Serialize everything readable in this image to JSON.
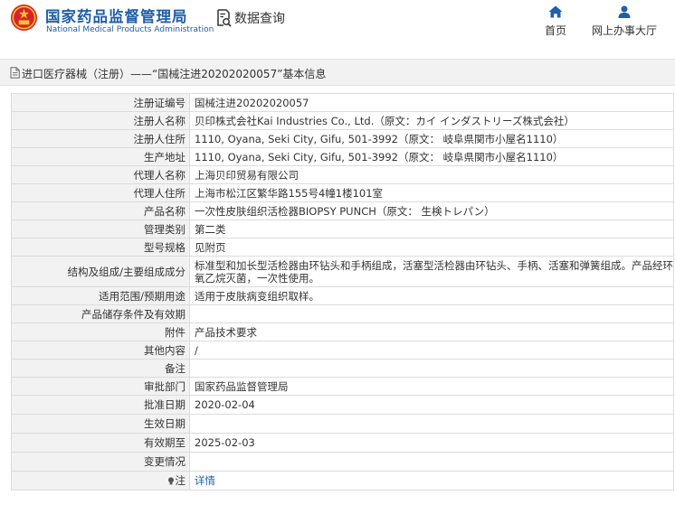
{
  "header": {
    "logo_cn": "国家药品监督管理局",
    "logo_en": "National Medical Products Administration",
    "data_query": "数据查询",
    "nav": {
      "home": "首页",
      "online": "网上办事大厅"
    }
  },
  "title": "进口医疗器械（注册）——“国械注进20202020057”基本信息",
  "rows": [
    {
      "label": "注册证编号",
      "value": "国械注进20202020057"
    },
    {
      "label": "注册人名称",
      "value": "贝印株式会社Kai Industries Co., Ltd.（原文：カイ インダストリーズ株式会社）"
    },
    {
      "label": "注册人住所",
      "value": "1110, Oyana, Seki City, Gifu, 501-3992（原文： 岐阜県関市小屋名1110）"
    },
    {
      "label": "生产地址",
      "value": "1110, Oyana, Seki City, Gifu, 501-3992（原文： 岐阜県関市小屋名1110）"
    },
    {
      "label": "代理人名称",
      "value": "上海贝印贸易有限公司"
    },
    {
      "label": "代理人住所",
      "value": "上海市松江区繁华路155号4幢1楼101室"
    },
    {
      "label": "产品名称",
      "value": "一次性皮肤组织活检器BIOPSY PUNCH（原文： 生検トレパン）"
    },
    {
      "label": "管理类别",
      "value": "第二类"
    },
    {
      "label": "型号规格",
      "value": "见附页"
    },
    {
      "label": "结构及组成/主要组成成分",
      "value": "标准型和加长型活检器由环钻头和手柄组成，活塞型活检器由环钻头、手柄、活塞和弹簧组成。产品经环氧乙烷灭菌，一次性使用。"
    },
    {
      "label": "适用范围/预期用途",
      "value": "适用于皮肤病变组织取样。"
    },
    {
      "label": "产品储存条件及有效期",
      "value": ""
    },
    {
      "label": "附件",
      "value": "产品技术要求"
    },
    {
      "label": "其他内容",
      "value": "/"
    },
    {
      "label": "备注",
      "value": ""
    },
    {
      "label": "审批部门",
      "value": "国家药品监督管理局"
    },
    {
      "label": "批准日期",
      "value": "2020-02-04"
    },
    {
      "label": "生效日期",
      "value": ""
    },
    {
      "label": "有效期至",
      "value": "2025-02-03"
    },
    {
      "label": "变更情况",
      "value": ""
    }
  ],
  "note": {
    "label": "注",
    "link": "详情"
  },
  "colors": {
    "brand_blue": "#1f5ea8",
    "label_bg": "#f2f2f2",
    "border": "#dcdcdc"
  },
  "icons": [
    "national-emblem-icon",
    "search-document-icon",
    "home-icon",
    "user-icon",
    "document-icon",
    "lightbulb-icon"
  ]
}
